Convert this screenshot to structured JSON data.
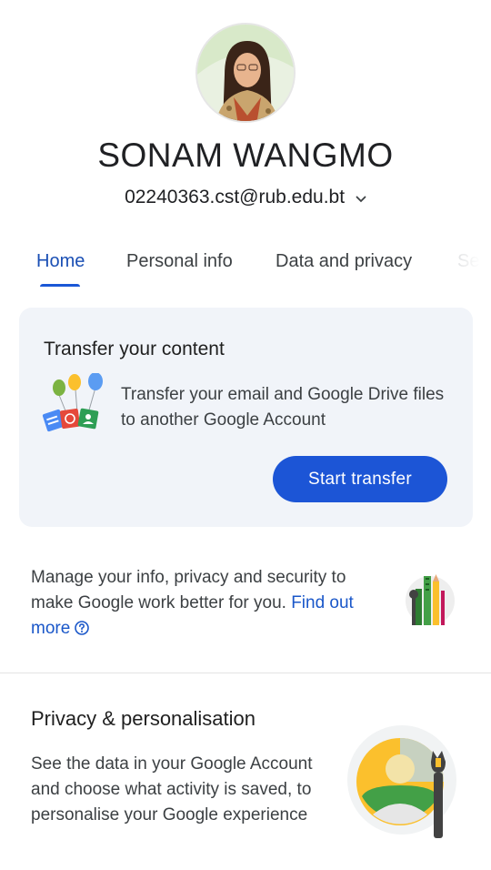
{
  "profile": {
    "name": "SONAM WANGMO",
    "email": "02240363.cst@rub.edu.bt"
  },
  "tabs": [
    {
      "label": "Home",
      "active": true
    },
    {
      "label": "Personal info",
      "active": false
    },
    {
      "label": "Data and privacy",
      "active": false
    },
    {
      "label": "Sec",
      "active": false
    }
  ],
  "transfer_card": {
    "title": "Transfer your content",
    "description": "Transfer your email and Google Drive files to another Google Account",
    "button_label": "Start transfer"
  },
  "manage": {
    "text": "Manage your info, privacy and security to make Google work better for you. ",
    "link": "Find out more"
  },
  "privacy": {
    "title": "Privacy & personalisation",
    "description": "See the data in your Google Account and choose what activity is saved, to personalise your Google experience"
  },
  "colors": {
    "accent": "#1c55d6",
    "card_bg": "#f1f4f9",
    "active_tab": "#1a4fb4"
  }
}
